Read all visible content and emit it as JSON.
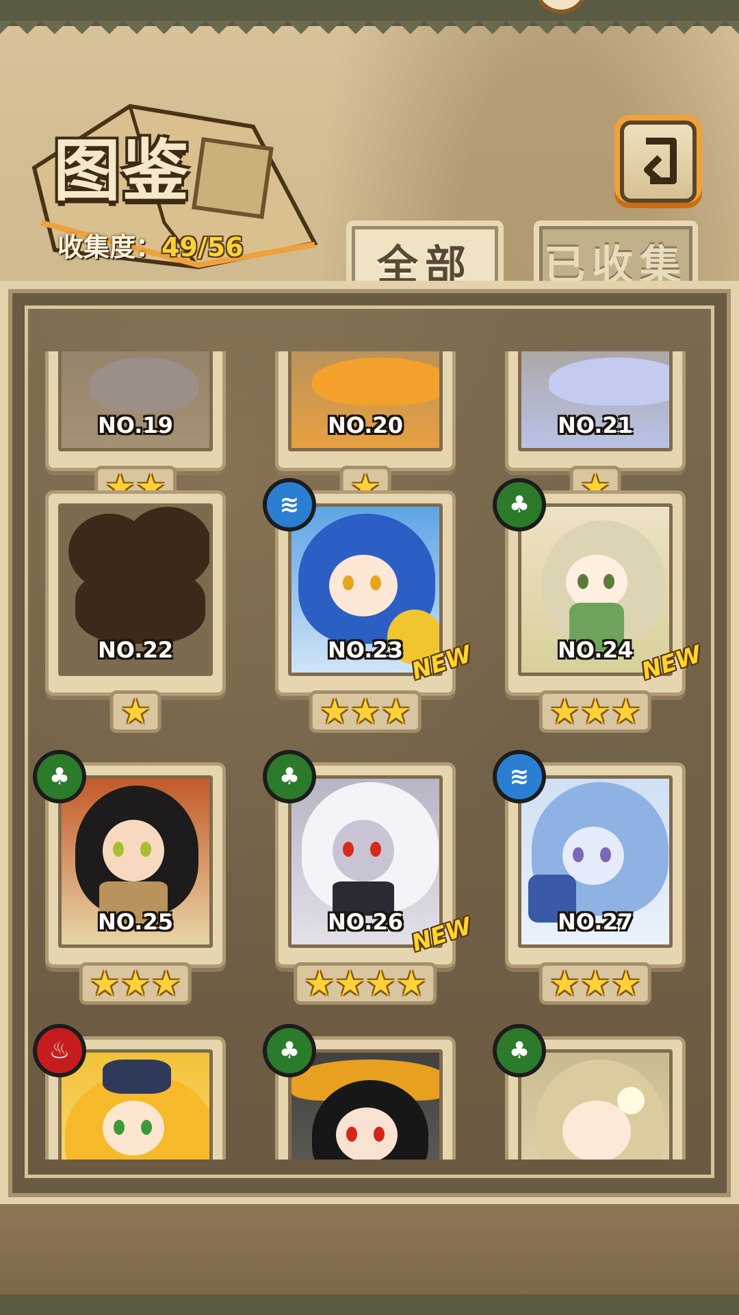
{
  "header": {
    "title": "图鉴",
    "collection_label": "收集度：",
    "collection_value": "49/56"
  },
  "tabs": [
    {
      "label": "全部",
      "active": true
    },
    {
      "label": "已收集",
      "active": false
    }
  ],
  "back_button": {
    "icon": "back-arrow-icon"
  },
  "cards": [
    {
      "no": "NO.19",
      "stars": "★★",
      "element": null,
      "new": false
    },
    {
      "no": "NO.20",
      "stars": "★",
      "element": null,
      "new": false
    },
    {
      "no": "NO.21",
      "stars": "★",
      "element": null,
      "new": false
    },
    {
      "no": "NO.22",
      "stars": "★",
      "element": null,
      "new": false,
      "collected": false
    },
    {
      "no": "NO.23",
      "stars": "★★★",
      "element": "water",
      "new": true
    },
    {
      "no": "NO.24",
      "stars": "★★★",
      "element": "leaf",
      "new": true
    },
    {
      "no": "NO.25",
      "stars": "★★★",
      "element": "leaf",
      "new": false
    },
    {
      "no": "NO.26",
      "stars": "★★★★",
      "element": "leaf",
      "new": true
    },
    {
      "no": "NO.27",
      "stars": "★★★",
      "element": "water",
      "new": false
    },
    {
      "no": "",
      "stars": "",
      "element": "fire",
      "new": false
    },
    {
      "no": "",
      "stars": "",
      "element": "leaf",
      "new": false
    },
    {
      "no": "",
      "stars": "",
      "element": "leaf",
      "new": false
    }
  ],
  "new_label": "NEW",
  "colors": {
    "star": "#ffd23a",
    "water": "#2a7fd3",
    "leaf": "#2c7a2c",
    "fire": "#c51d1d"
  }
}
